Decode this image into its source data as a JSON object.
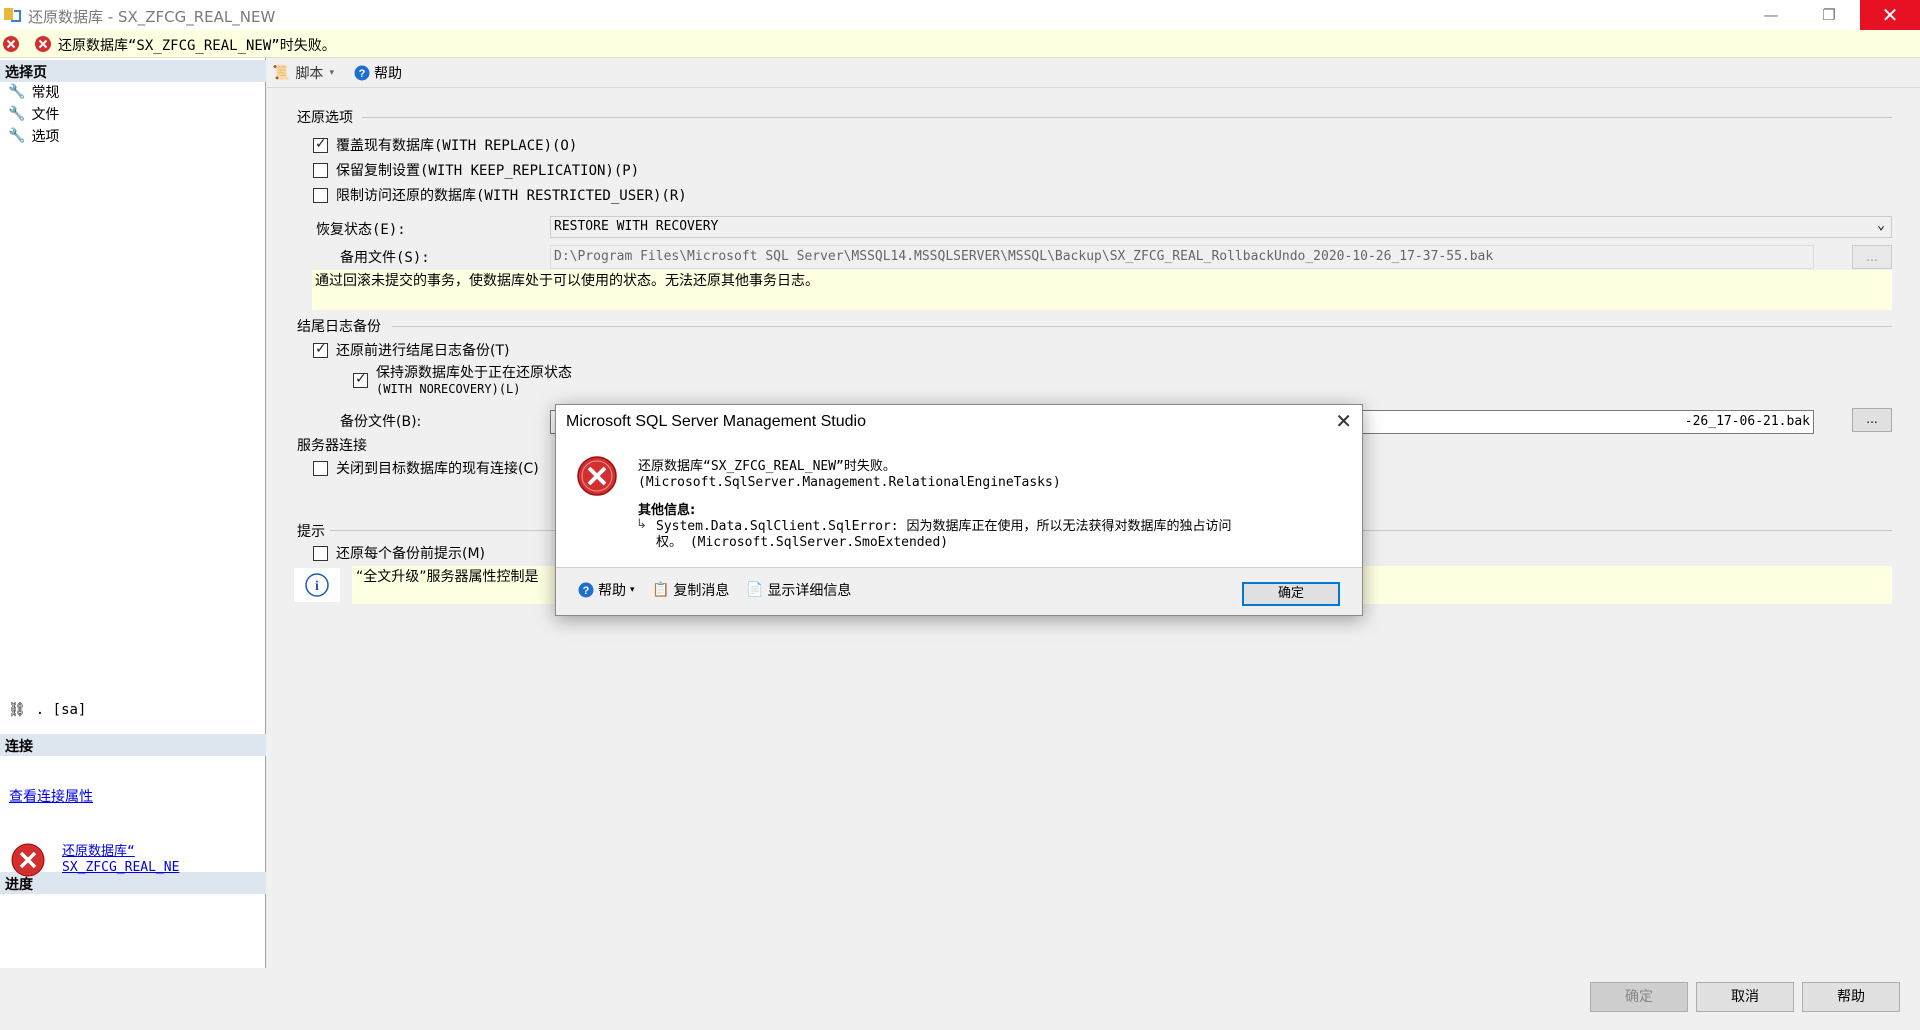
{
  "window": {
    "title": "还原数据库 - SX_ZFCG_REAL_NEW",
    "minimize": "—",
    "restore": "❐",
    "close": "✕"
  },
  "banner": {
    "message": "还原数据库“SX_ZFCG_REAL_NEW”时失败。"
  },
  "left": {
    "select_page_header": "选择页",
    "pages": [
      {
        "label": "常规",
        "icon": "wrench-icon"
      },
      {
        "label": "文件",
        "icon": "wrench-icon"
      },
      {
        "label": "选项",
        "icon": "wrench-icon"
      }
    ],
    "connection_header": "连接",
    "connection_value": ". [sa]",
    "view_connection_link": "查看连接属性",
    "progress_header": "进度",
    "progress_link_line1": "还原数据库“",
    "progress_link_line2": "SX_ZFCG_REAL_NE"
  },
  "toolbar": {
    "script_label": "脚本",
    "help_label": "帮助"
  },
  "restore_options": {
    "group_title": "还原选项",
    "opt_replace": "覆盖现有数据库(WITH REPLACE)(O)",
    "opt_replace_checked": true,
    "opt_keep_replication": "保留复制设置(WITH KEEP_REPLICATION)(P)",
    "opt_keep_replication_checked": false,
    "opt_restricted": "限制访问还原的数据库(WITH RESTRICTED_USER)(R)",
    "opt_restricted_checked": false,
    "recovery_state_label": "恢复状态(E):",
    "recovery_state_value": "RESTORE WITH RECOVERY",
    "standby_file_label": "备用文件(S):",
    "standby_file_value": "D:\\Program Files\\Microsoft SQL Server\\MSSQL14.MSSQLSERVER\\MSSQL\\Backup\\SX_ZFCG_REAL_RollbackUndo_2020-10-26_17-37-55.bak",
    "standby_browse": "...",
    "recovery_description": "通过回滚未提交的事务，使数据库处于可以使用的状态。无法还原其他事务日志。"
  },
  "tail_log": {
    "group_title": "结尾日志备份",
    "opt_tail_backup": "还原前进行结尾日志备份(T)",
    "opt_tail_backup_checked": true,
    "opt_norecovery_line1": "保持源数据库处于正在还原状态",
    "opt_norecovery_line2": "(WITH NORECOVERY)(L)",
    "opt_norecovery_checked": true,
    "backup_file_label": "备份文件(B):",
    "backup_file_value": "-26_17-06-21.bak",
    "backup_browse": "..."
  },
  "server_conn": {
    "group_title": "服务器连接",
    "opt_close_existing": "关闭到目标数据库的现有连接(C)",
    "opt_close_existing_checked": false
  },
  "hints": {
    "group_title": "提示",
    "opt_prompt_each": "还原每个备份前提示(M)",
    "opt_prompt_each_checked": false,
    "info_text": "“全文升级”服务器属性控制是"
  },
  "bottom": {
    "ok": "确定",
    "cancel": "取消",
    "help": "帮助"
  },
  "dialog": {
    "title": "Microsoft SQL Server Management Studio",
    "close": "✕",
    "message_line1": "还原数据库“SX_ZFCG_REAL_NEW”时失败。",
    "message_line2": "(Microsoft.SqlServer.Management.RelationalEngineTasks)",
    "extra_info_title": "其他信息:",
    "detail_line1": "System.Data.SqlClient.SqlError: 因为数据库正在使用，所以无法获得对数据库的独占访问",
    "detail_line2": "权。 (Microsoft.SqlServer.SmoExtended)",
    "help_label": "帮助",
    "copy_label": "复制消息",
    "details_label": "显示详细信息",
    "ok_label": "确定"
  },
  "colors": {
    "error_red": "#e81123",
    "banner_yellow": "#ffffe1",
    "header_blue": "#dde5ee",
    "link": "#0000ee"
  }
}
